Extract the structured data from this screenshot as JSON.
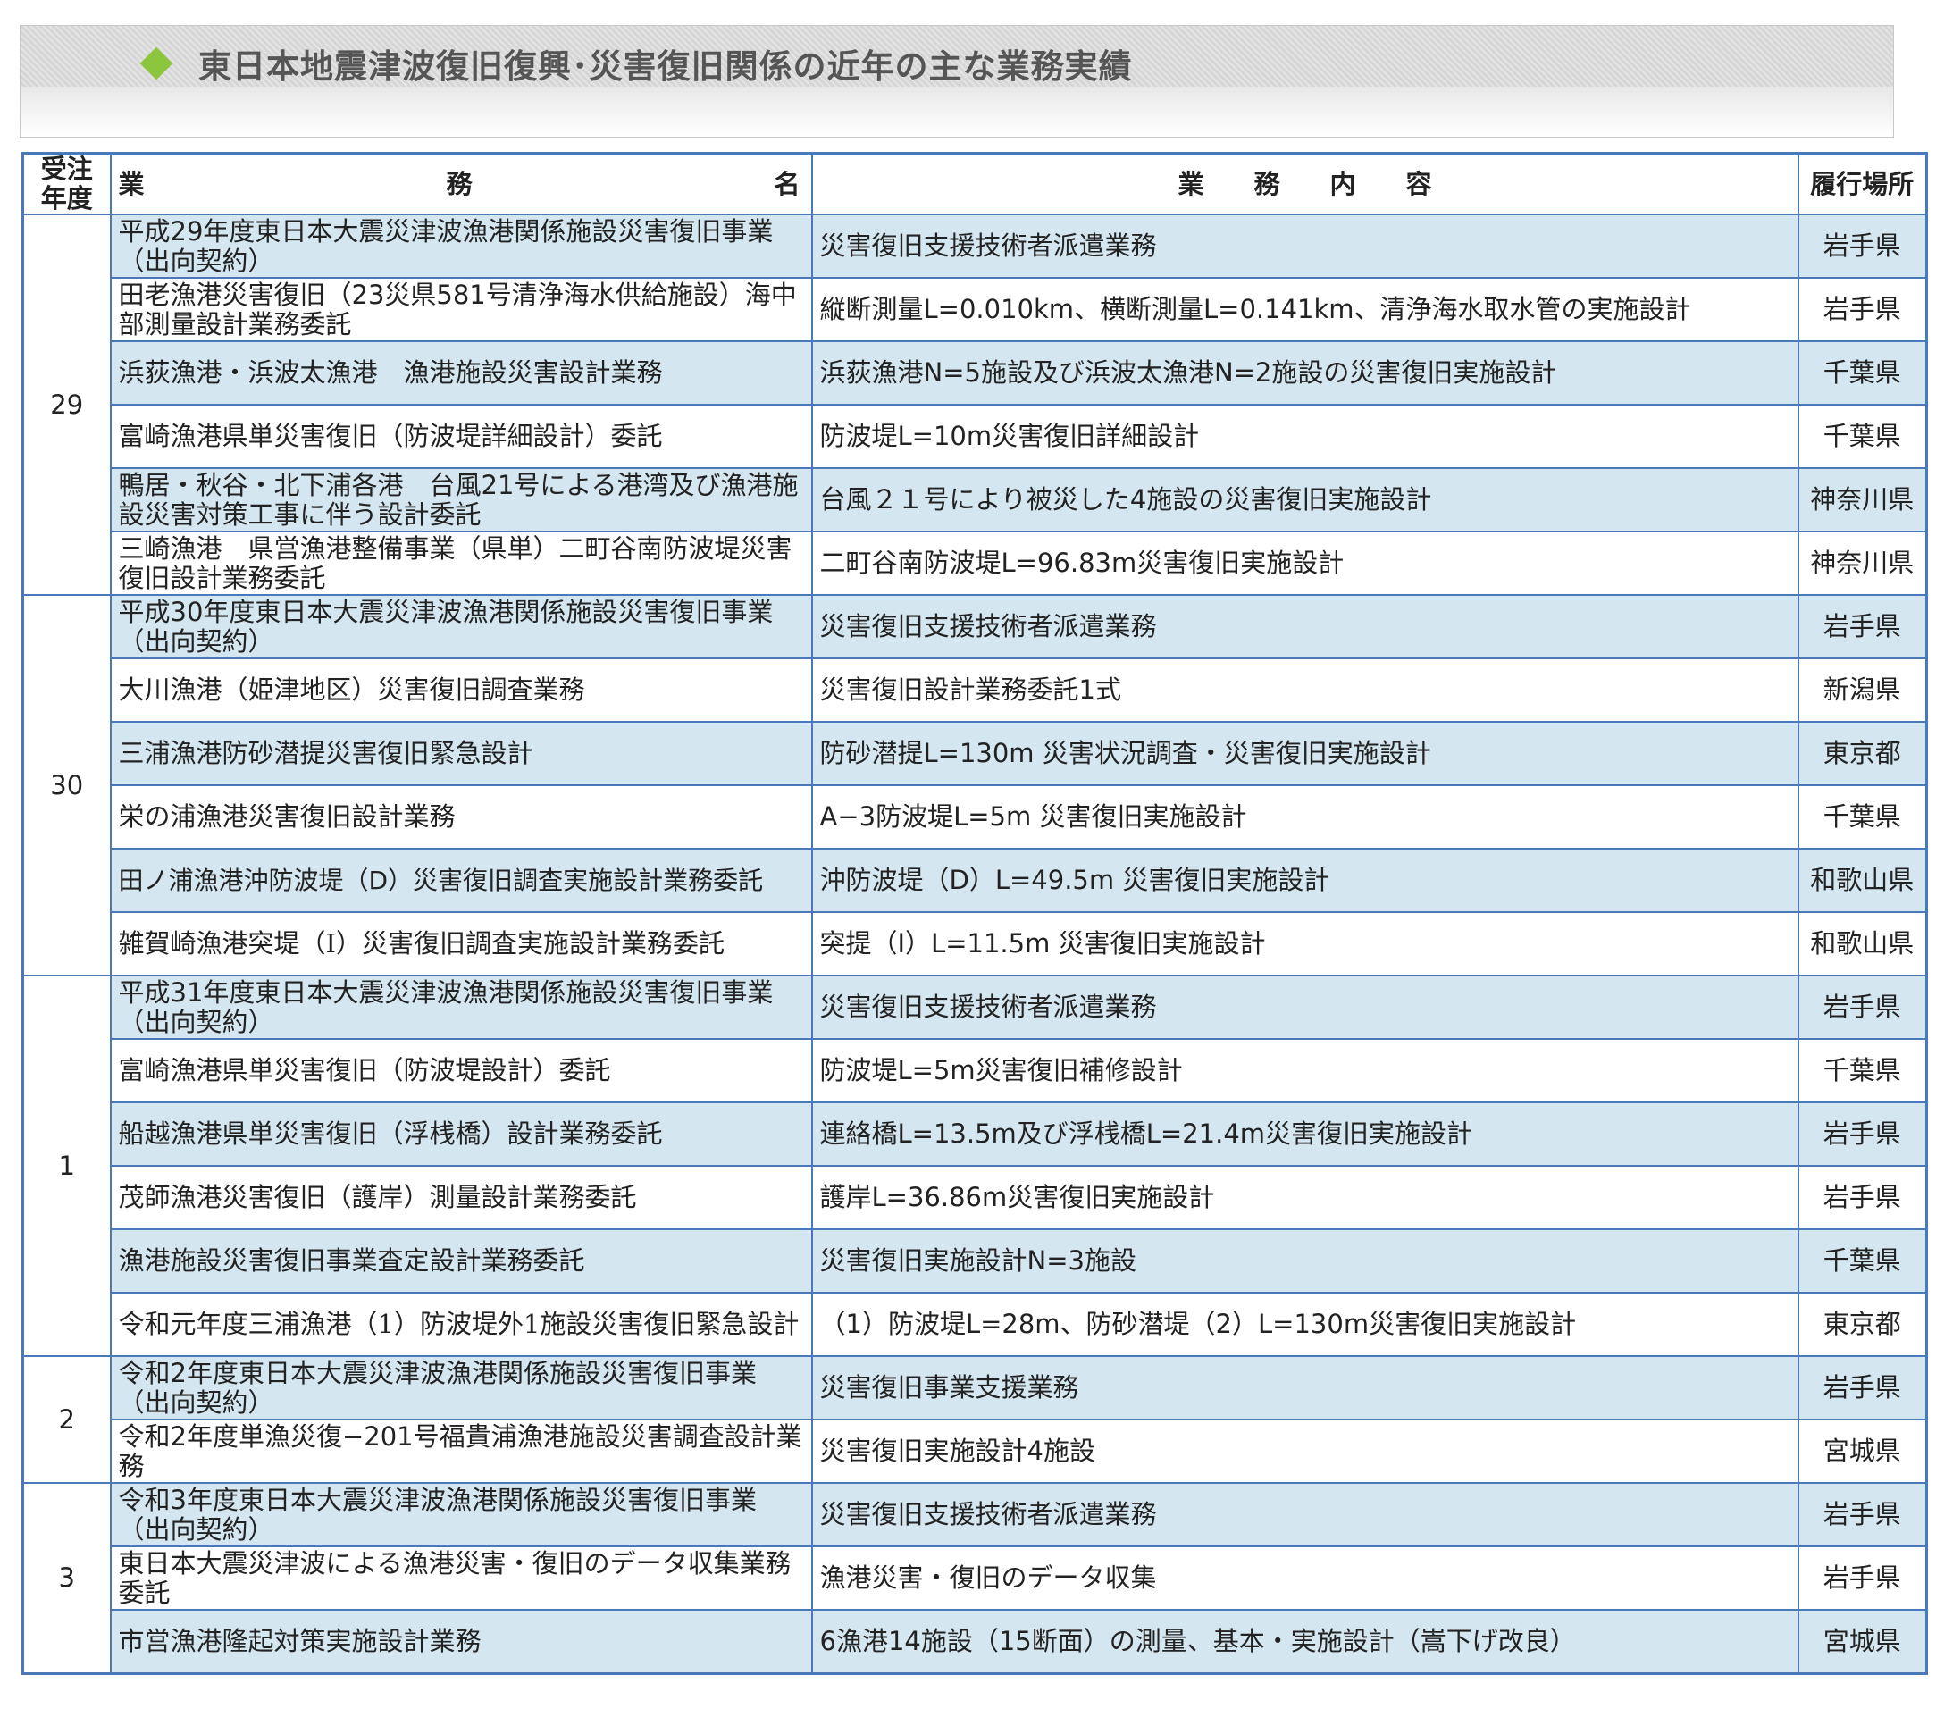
{
  "title": "東日本地震津波復旧復興･災害復旧関係の近年の主な業務実績",
  "table": {
    "headers": {
      "year_line1": "受注",
      "year_line2": "年度",
      "name_chars": [
        "業",
        "務",
        "名"
      ],
      "content_chars": [
        "業",
        "務",
        "内",
        "容"
      ],
      "place": "履行場所"
    },
    "groups": [
      {
        "year": "29",
        "rows": [
          {
            "name": "平成29年度東日本大震災津波漁港関係施設災害復旧事業（出向契約）",
            "content": "災害復旧支援技術者派遣業務",
            "place": "岩手県"
          },
          {
            "name": "田老漁港災害復旧（23災県581号清浄海水供給施設）海中部測量設計業務委託",
            "content": "縦断測量L=0.010km、横断測量L=0.141km、清浄海水取水管の実施設計",
            "place": "岩手県"
          },
          {
            "name": "浜荻漁港・浜波太漁港　漁港施設災害設計業務",
            "content": "浜荻漁港N=5施設及び浜波太漁港N=2施設の災害復旧実施設計",
            "place": "千葉県"
          },
          {
            "name": "富崎漁港県単災害復旧（防波堤詳細設計）委託",
            "content": "防波堤L=10m災害復旧詳細設計",
            "place": "千葉県"
          },
          {
            "name": "鴨居・秋谷・北下浦各港　台風21号による港湾及び漁港施設災害対策工事に伴う設計委託",
            "content": "台風２１号により被災した4施設の災害復旧実施設計",
            "place": "神奈川県"
          },
          {
            "name": "三崎漁港　県営漁港整備事業（県単）二町谷南防波堤災害復旧設計業務委託",
            "content": "二町谷南防波堤L=96.83m災害復旧実施設計",
            "place": "神奈川県"
          }
        ]
      },
      {
        "year": "30",
        "rows": [
          {
            "name": "平成30年度東日本大震災津波漁港関係施設災害復旧事業（出向契約）",
            "content": "災害復旧支援技術者派遣業務",
            "place": "岩手県"
          },
          {
            "name": "大川漁港（姫津地区）災害復旧調査業務",
            "content": "災害復旧設計業務委託1式",
            "place": "新潟県"
          },
          {
            "name": "三浦漁港防砂潜提災害復旧緊急設計",
            "content": "防砂潜提L=130m 災害状況調査・災害復旧実施設計",
            "place": "東京都",
            "light": true
          },
          {
            "name": "栄の浦漁港災害復旧設計業務",
            "content": "A−3防波堤L=5m 災害復旧実施設計",
            "place": "千葉県"
          },
          {
            "name": "田ノ浦漁港沖防波堤（D）災害復旧調査実施設計業務委託",
            "content": "沖防波堤（D）L=49.5m 災害復旧実施設計",
            "place": "和歌山県",
            "nowrap": true
          },
          {
            "name": "雑賀崎漁港突堤（I）災害復旧調査実施設計業務委託",
            "content": "突提（I）L=11.5m 災害復旧実施設計",
            "place": "和歌山県",
            "light": true
          }
        ]
      },
      {
        "year": "1",
        "rows": [
          {
            "name": "平成31年度東日本大震災津波漁港関係施設災害復旧事業（出向契約）",
            "content": "災害復旧支援技術者派遣業務",
            "place": "岩手県"
          },
          {
            "name": "富崎漁港県単災害復旧（防波堤設計）委託",
            "content": "防波堤L=5m災害復旧補修設計",
            "place": "千葉県"
          },
          {
            "name": "船越漁港県単災害復旧（浮桟橋）設計業務委託",
            "content": "連絡橋L=13.5m及び浮桟橋L=21.4m災害復旧実施設計",
            "place": "岩手県",
            "light": true
          },
          {
            "name": "茂師漁港災害復旧（護岸）測量設計業務委託",
            "content": "護岸L=36.86m災害復旧実施設計",
            "place": "岩手県",
            "light": true
          },
          {
            "name": "漁港施設災害復旧事業査定設計業務委託",
            "content": "災害復旧実施設計N=3施設",
            "place": "千葉県",
            "light": true
          },
          {
            "name": "令和元年度三浦漁港（1）防波堤外1施設災害復旧緊急設計",
            "content": "（1）防波堤L=28m、防砂潜堤（2）L=130m災害復旧実施設計",
            "place": "東京都",
            "light": true
          }
        ]
      },
      {
        "year": "2",
        "rows": [
          {
            "name": "令和2年度東日本大震災津波漁港関係施設災害復旧事業（出向契約）",
            "content": "災害復旧事業支援業務",
            "place": "岩手県"
          },
          {
            "name": "令和2年度単漁災復−201号福貴浦漁港施設災害調査設計業務",
            "content": "災害復旧実施設計4施設",
            "place": "宮城県"
          }
        ]
      },
      {
        "year": "3",
        "rows": [
          {
            "name": "令和3年度東日本大震災津波漁港関係施設災害復旧事業（出向契約）",
            "content": "災害復旧支援技術者派遣業務",
            "place": "岩手県"
          },
          {
            "name": "東日本大震災津波による漁港災害・復旧のデータ収集業務委託",
            "content": "漁港災害・復旧のデータ収集",
            "place": "岩手県"
          },
          {
            "name": "市営漁港隆起対策実施設計業務",
            "content": "6漁港14施設（15断面）の測量、基本・実施設計（嵩下げ改良）",
            "place": "宮城県"
          }
        ]
      }
    ]
  }
}
